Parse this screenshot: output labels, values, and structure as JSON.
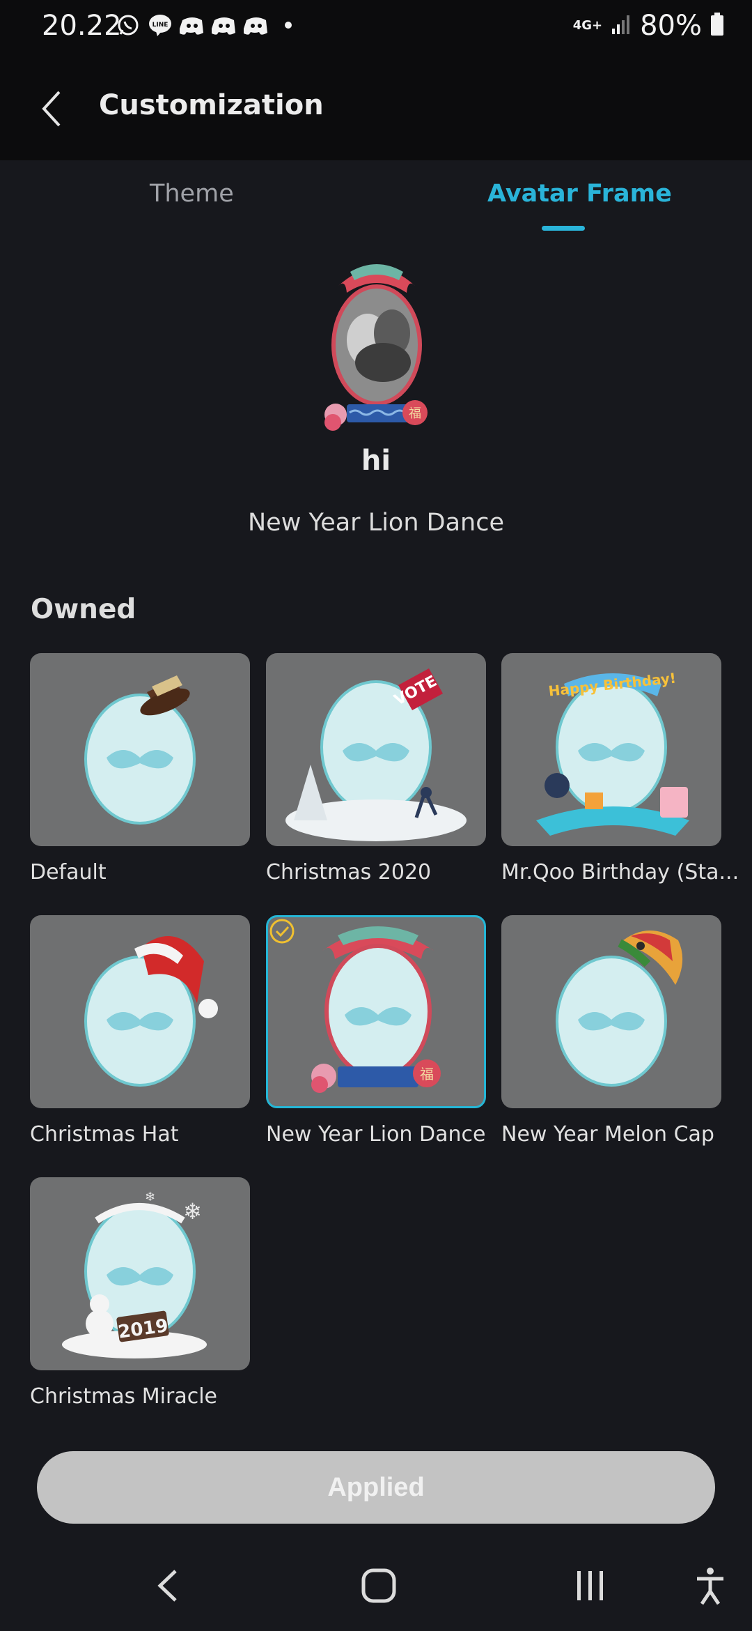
{
  "status_bar": {
    "time": "20.22",
    "network": "4G+",
    "battery": "80%",
    "app_icons": [
      "whatsapp-icon",
      "line-icon",
      "discord-icon",
      "discord-icon",
      "discord-icon",
      "dot-icon"
    ]
  },
  "header": {
    "title": "Customization",
    "back_icon": "chevron-left-icon"
  },
  "tabs": [
    {
      "label": "Theme",
      "active": false
    },
    {
      "label": "Avatar Frame",
      "active": true
    }
  ],
  "preview": {
    "user_name": "hi",
    "frame_name": "New Year Lion Dance"
  },
  "owned": {
    "title": "Owned",
    "items": [
      {
        "label": "Default",
        "selected": false
      },
      {
        "label": "Christmas 2020",
        "selected": false
      },
      {
        "label": "Mr.Qoo Birthday (Sta...",
        "selected": false
      },
      {
        "label": "Christmas Hat",
        "selected": false
      },
      {
        "label": "New Year Lion Dance",
        "selected": true
      },
      {
        "label": "New Year Melon Cap",
        "selected": false
      },
      {
        "label": "Christmas Miracle",
        "selected": false
      }
    ]
  },
  "action_button": {
    "label": "Applied"
  },
  "colors": {
    "accent": "#2ab4d9",
    "background": "#17181d",
    "card": "#6f7071",
    "button": "#c3c3c3"
  }
}
